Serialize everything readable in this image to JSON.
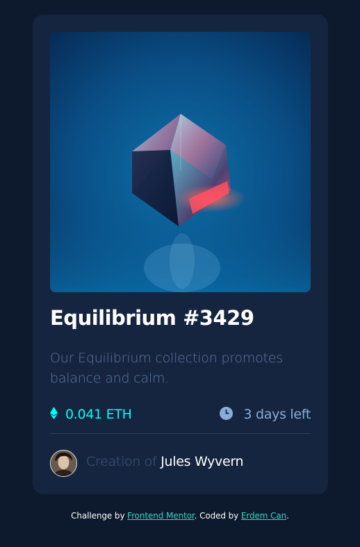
{
  "card": {
    "image_alt": "Equilibrium crystal cube",
    "title": "Equilibrium #3429",
    "description": "Our Equilibrium collection promotes balance and calm.",
    "price": "0.041 ETH",
    "time_left": "3 days left",
    "creator_prefix": "Creation of ",
    "creator_name": "Jules Wyvern"
  },
  "footer": {
    "prefix": "Challenge by ",
    "challenge_link": "Frontend Mentor",
    "middle": ". Coded by ",
    "author_link": "Erdem Can",
    "suffix": "."
  },
  "icons": {
    "price": "ethereum-icon",
    "time": "clock-icon"
  },
  "colors": {
    "page_bg": "#0d192c",
    "card_bg": "#15253f",
    "accent_cyan": "#00fff7",
    "soft_blue": "#8bacd9",
    "muted_text": "#5f7a9e",
    "link": "#3fd6c2"
  }
}
